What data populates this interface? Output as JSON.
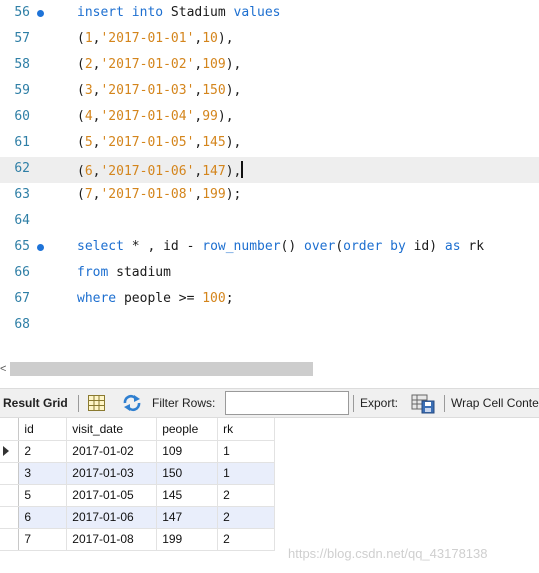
{
  "editor": {
    "lines": [
      {
        "no": "56",
        "dot": true,
        "tokens": [
          [
            "kw",
            "insert into"
          ],
          [
            "plain",
            " Stadium "
          ],
          [
            "kw",
            "values"
          ]
        ]
      },
      {
        "no": "57",
        "dot": false,
        "tokens": [
          [
            "plain",
            "("
          ],
          [
            "num",
            "1"
          ],
          [
            "plain",
            ","
          ],
          [
            "str",
            "'2017-01-01'"
          ],
          [
            "plain",
            ","
          ],
          [
            "num",
            "10"
          ],
          [
            "plain",
            "),"
          ]
        ]
      },
      {
        "no": "58",
        "dot": false,
        "tokens": [
          [
            "plain",
            "("
          ],
          [
            "num",
            "2"
          ],
          [
            "plain",
            ","
          ],
          [
            "str",
            "'2017-01-02'"
          ],
          [
            "plain",
            ","
          ],
          [
            "num",
            "109"
          ],
          [
            "plain",
            "),"
          ]
        ]
      },
      {
        "no": "59",
        "dot": false,
        "tokens": [
          [
            "plain",
            "("
          ],
          [
            "num",
            "3"
          ],
          [
            "plain",
            ","
          ],
          [
            "str",
            "'2017-01-03'"
          ],
          [
            "plain",
            ","
          ],
          [
            "num",
            "150"
          ],
          [
            "plain",
            "),"
          ]
        ]
      },
      {
        "no": "60",
        "dot": false,
        "tokens": [
          [
            "plain",
            "("
          ],
          [
            "num",
            "4"
          ],
          [
            "plain",
            ","
          ],
          [
            "str",
            "'2017-01-04'"
          ],
          [
            "plain",
            ","
          ],
          [
            "num",
            "99"
          ],
          [
            "plain",
            "),"
          ]
        ]
      },
      {
        "no": "61",
        "dot": false,
        "tokens": [
          [
            "plain",
            "("
          ],
          [
            "num",
            "5"
          ],
          [
            "plain",
            ","
          ],
          [
            "str",
            "'2017-01-05'"
          ],
          [
            "plain",
            ","
          ],
          [
            "num",
            "145"
          ],
          [
            "plain",
            "),"
          ]
        ]
      },
      {
        "no": "62",
        "dot": false,
        "current": true,
        "tokens": [
          [
            "plain",
            "("
          ],
          [
            "num",
            "6"
          ],
          [
            "plain",
            ","
          ],
          [
            "str",
            "'2017-01-06'"
          ],
          [
            "plain",
            ","
          ],
          [
            "num",
            "147"
          ],
          [
            "plain",
            "),"
          ]
        ]
      },
      {
        "no": "63",
        "dot": false,
        "tokens": [
          [
            "plain",
            "("
          ],
          [
            "num",
            "7"
          ],
          [
            "plain",
            ","
          ],
          [
            "str",
            "'2017-01-08'"
          ],
          [
            "plain",
            ","
          ],
          [
            "num",
            "199"
          ],
          [
            "plain",
            ");"
          ]
        ]
      },
      {
        "no": "64",
        "dot": false,
        "tokens": []
      },
      {
        "no": "65",
        "dot": true,
        "tokens": [
          [
            "kw",
            "select"
          ],
          [
            "plain",
            " * , id - "
          ],
          [
            "fn",
            "row_number"
          ],
          [
            "plain",
            "() "
          ],
          [
            "kw",
            "over"
          ],
          [
            "plain",
            "("
          ],
          [
            "kw",
            "order by"
          ],
          [
            "plain",
            " id) "
          ],
          [
            "kw",
            "as"
          ],
          [
            "plain",
            " rk"
          ]
        ]
      },
      {
        "no": "66",
        "dot": false,
        "tokens": [
          [
            "kw",
            "from"
          ],
          [
            "plain",
            " stadium"
          ]
        ]
      },
      {
        "no": "67",
        "dot": false,
        "tokens": [
          [
            "kw",
            "where"
          ],
          [
            "plain",
            " people >= "
          ],
          [
            "num",
            "100"
          ],
          [
            "plain",
            ";"
          ]
        ]
      },
      {
        "no": "68",
        "dot": false,
        "tokens": []
      }
    ]
  },
  "scrollbar": {
    "left_arrow": "<"
  },
  "toolbar": {
    "result_grid_label": "Result Grid",
    "filter_rows_label": "Filter Rows:",
    "filter_value": "",
    "export_label": "Export:",
    "wrap_label": "Wrap Cell Conte"
  },
  "grid": {
    "columns": [
      "id",
      "visit_date",
      "people",
      "rk"
    ],
    "rows": [
      [
        "2",
        "2017-01-02",
        "109",
        "1"
      ],
      [
        "3",
        "2017-01-03",
        "150",
        "1"
      ],
      [
        "5",
        "2017-01-05",
        "145",
        "2"
      ],
      [
        "6",
        "2017-01-06",
        "147",
        "2"
      ],
      [
        "7",
        "2017-01-08",
        "199",
        "2"
      ]
    ],
    "current_row": 0
  },
  "watermark": "https://blog.csdn.net/qq_43178138"
}
